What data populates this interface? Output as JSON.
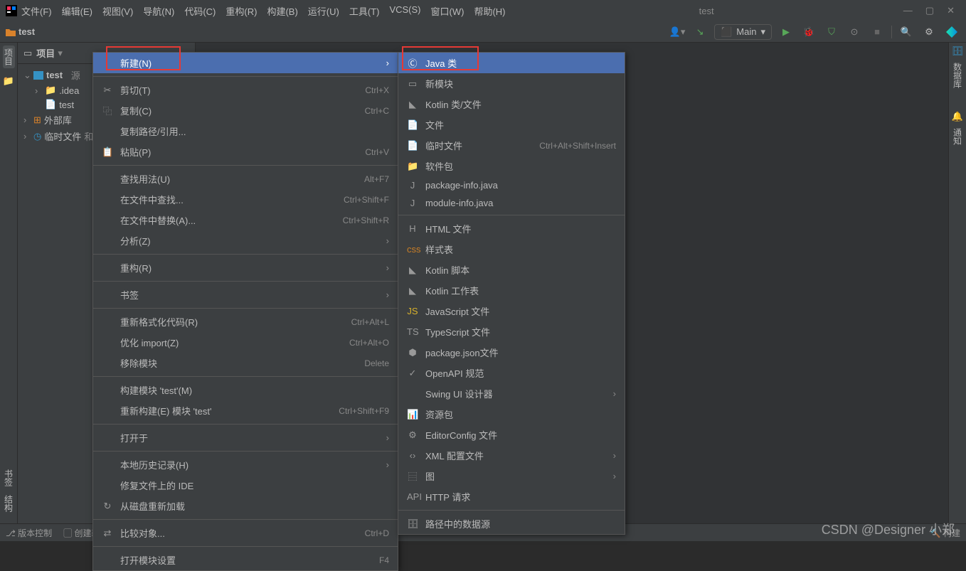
{
  "titlebar": {
    "menus": [
      "文件(F)",
      "编辑(E)",
      "视图(V)",
      "导航(N)",
      "代码(C)",
      "重构(R)",
      "构建(B)",
      "运行(U)",
      "工具(T)",
      "VCS(S)",
      "窗口(W)",
      "帮助(H)"
    ],
    "title": "test"
  },
  "toolbar": {
    "breadcrumb": "test",
    "run_config": "Main"
  },
  "left_tabs": {
    "project": "项目"
  },
  "right_tabs": {
    "db": "数据库",
    "notifications": "通知"
  },
  "bottom_left_tabs": {
    "bookmarks": "书签",
    "structure": "结构"
  },
  "project_panel": {
    "tab": "项目",
    "nodes": {
      "root": "test",
      "root_suffix": "源",
      "idea": ".idea",
      "test_inner": "test",
      "ext": "外部库",
      "temp": "临时文件",
      "temp_suffix": "和"
    }
  },
  "ctx1": {
    "new": "新建(N)",
    "cut": "剪切(T)",
    "cut_k": "Ctrl+X",
    "copy": "复制(C)",
    "copy_k": "Ctrl+C",
    "copy_path": "复制路径/引用...",
    "paste": "粘贴(P)",
    "paste_k": "Ctrl+V",
    "find_usage": "查找用法(U)",
    "find_usage_k": "Alt+F7",
    "find_in": "在文件中查找...",
    "find_in_k": "Ctrl+Shift+F",
    "replace_in": "在文件中替换(A)...",
    "replace_in_k": "Ctrl+Shift+R",
    "analyze": "分析(Z)",
    "refactor": "重构(R)",
    "bookmark": "书签",
    "reformat": "重新格式化代码(R)",
    "reformat_k": "Ctrl+Alt+L",
    "optimize": "优化 import(Z)",
    "optimize_k": "Ctrl+Alt+O",
    "delete": "移除模块",
    "delete_k": "Delete",
    "build_module": "构建模块 'test'(M)",
    "rebuild": "重新构建(E) 模块 'test'",
    "rebuild_k": "Ctrl+Shift+F9",
    "open_in": "打开于",
    "history": "本地历史记录(H)",
    "repair": "修复文件上的 IDE",
    "reload": "从磁盘重新加载",
    "compare": "比较对象...",
    "compare_k": "Ctrl+D",
    "module_settings": "打开模块设置",
    "module_settings_k": "F4"
  },
  "ctx2": {
    "java_class": "Java 类",
    "new_module": "新模块",
    "kotlin_class": "Kotlin 类/文件",
    "file": "文件",
    "scratch": "临时文件",
    "scratch_k": "Ctrl+Alt+Shift+Insert",
    "package": "软件包",
    "package_info": "package-info.java",
    "module_info": "module-info.java",
    "html_file": "HTML 文件",
    "stylesheet": "样式表",
    "kotlin_script": "Kotlin 脚本",
    "kotlin_worksheet": "Kotlin 工作表",
    "js_file": "JavaScript 文件",
    "ts_file": "TypeScript 文件",
    "package_json": "package.json文件",
    "openapi": "OpenAPI 规范",
    "swing": "Swing UI 设计器",
    "resource": "资源包",
    "editorconfig": "EditorConfig 文件",
    "xml_config": "XML 配置文件",
    "image": "图",
    "http_request": "HTTP 请求",
    "datasource": "路径中的数据源"
  },
  "statusbar": {
    "vcs": "版本控制",
    "create_class": "创建新 Java 类",
    "build": "构建"
  },
  "watermark": "CSDN @Designer 小郑"
}
